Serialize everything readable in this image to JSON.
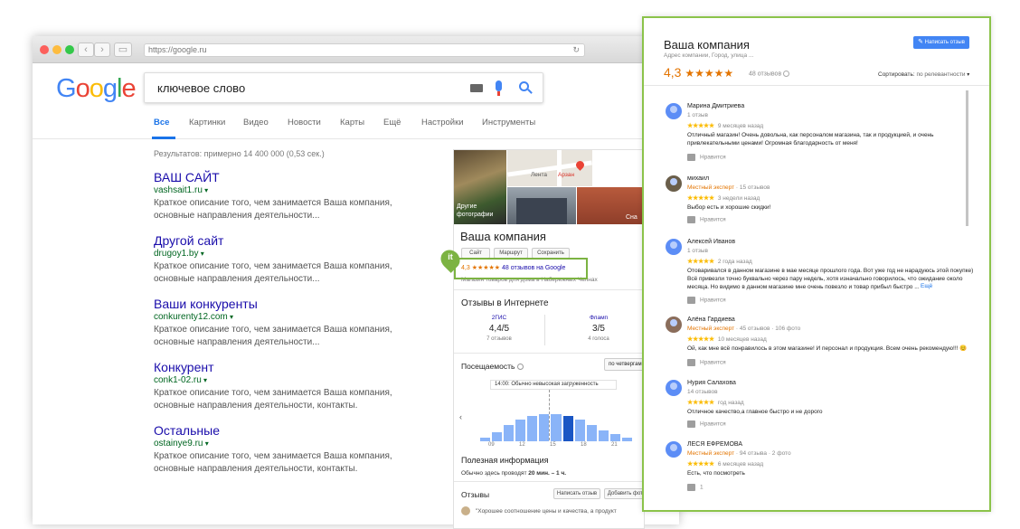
{
  "browser": {
    "url": "https://google.ru",
    "logo_letters": [
      "G",
      "o",
      "o",
      "g",
      "l",
      "e"
    ],
    "logo_colors": [
      "#4285f4",
      "#ea4335",
      "#fbbc05",
      "#4285f4",
      "#34a853",
      "#ea4335"
    ]
  },
  "search": {
    "query": "ключевое слово"
  },
  "tabs": [
    "Все",
    "Картинки",
    "Видео",
    "Новости",
    "Карты",
    "Ещё",
    "Настройки",
    "Инструменты"
  ],
  "stats": "Результатов: примерно 14 400 000 (0,53 сек.)",
  "results": [
    {
      "title": "ВАШ САЙТ",
      "url": "vashsait1.ru",
      "desc1": "Краткое описание того, чем занимается Ваша компания,",
      "desc2": "основные направления деятельности..."
    },
    {
      "title": "Другой сайт",
      "url": "drugoy1.by",
      "desc1": "Краткое описание того, чем занимается Ваша компания,",
      "desc2": "основные направления деятельности..."
    },
    {
      "title": "Ваши конкуренты",
      "url": "conkurenty12.com",
      "desc1": "Краткое описание того, чем занимается Ваша компания,",
      "desc2": "основные направления деятельности..."
    },
    {
      "title": "Конкурент",
      "url": "conk1-02.ru",
      "desc1": "Краткое описание того, чем занимается Ваша компания,",
      "desc2": "основные направления деятельности, контакты."
    },
    {
      "title": "Остальные",
      "url": "ostainye9.ru",
      "desc1": "Краткое описание того, чем занимается Ваша компания,",
      "desc2": "основные направления деятельности, контакты."
    }
  ],
  "knowledge_panel": {
    "photos_label_1": "Другие",
    "photos_label_2": "фотографии",
    "map_label_1": "Лента",
    "map_label_2": "Арзан",
    "photo_right_label": "Сна",
    "title": "Ваша компания",
    "buttons": [
      "Сайт",
      "Маршрут",
      "Сохранить"
    ],
    "rating": "4,3",
    "stars": "★★★★★",
    "reviews_link": "48 отзывов на Google",
    "category": "Магазин товаров для дома в Набережных Челнах",
    "online_reviews_title": "Отзывы в Интернете",
    "sources": [
      {
        "name": "2ГИС",
        "score": "4,4/5",
        "count": "7 отзывов"
      },
      {
        "name": "Фламп",
        "score": "3/5",
        "count": "4 голоса"
      }
    ],
    "attendance_title": "Посещаемость",
    "attendance_btn": "по четвергам",
    "attendance_now": "14:00: Обычно невысокая загруженность",
    "hours": [
      "09",
      "12",
      "15",
      "18",
      "21"
    ],
    "bars": [
      0.1,
      0.25,
      0.45,
      0.6,
      0.7,
      0.75,
      0.75,
      0.7,
      0.6,
      0.45,
      0.3,
      0.2,
      0.1
    ],
    "useful_title": "Полезная информация",
    "useful_text_a": "Обычно здесь проводят ",
    "useful_text_b": "20 мин. – 1 ч.",
    "reviews_title": "Отзывы",
    "write_btn": "Написать отзыв",
    "add_btn": "Добавить фото",
    "quote": "\"Хорошее соотношение цены и качества, а продукт",
    "badge": "it"
  },
  "review_panel": {
    "title": "Ваша компания",
    "address": "Адрес компании, Город, улица ...",
    "write_btn": "Написать отзыв",
    "rating": "4,3",
    "stars": "★★★★★",
    "count": "48 отзывов",
    "sort_label": "Сортировать:",
    "sort_value": "по релевантности",
    "like_label": "Нравится",
    "more": "Ещё",
    "reviews": [
      {
        "name": "Марина Дмитриева",
        "meta": "1 отзыв",
        "expert": "",
        "stars": "★★★★★",
        "ago": "9 месяцев назад",
        "text": "Отличный магазин! Очень довольна, как персоналом магазина, так и продукцией, и очень привлекательными ценами! Огромная благодарность от меня!",
        "likes": ""
      },
      {
        "name": "михаил",
        "meta": " · 15 отзывов",
        "expert": "Местный эксперт",
        "stars": "★★★★★",
        "ago": "3 недели назад",
        "text": "Выбор есть и хорошие скидки!",
        "likes": ""
      },
      {
        "name": "Алексей Иванов",
        "meta": "1 отзыв",
        "expert": "",
        "stars": "★★★★★",
        "ago": "2 года назад",
        "text": "Отоваривался в данном магазине в мае месяце прошлого года. Вот уже год не нарадуюсь этой покупке) Всё привезли точно буквально через пару недель, хотя изначально говорилось, что ожидание около месяца. Но видимо в данном магазине мне очень повезло и товар прибыл быстро ...",
        "likes": ""
      },
      {
        "name": "Алёна Гардиева",
        "meta": " · 45 отзывов · 106 фото",
        "expert": "Местный эксперт",
        "stars": "★★★★★",
        "ago": "10 месяцев назад",
        "text": "Ой, как мне всё понравилось в этом магазине! И персонал и продукция. Всем очень рекомендую!!! 😊",
        "likes": ""
      },
      {
        "name": "Нурия Салахова",
        "meta": "14 отзывов",
        "expert": "",
        "stars": "★★★★★",
        "ago": "год назад",
        "text": "Отличное качество,а главное быстро и не дорого",
        "likes": ""
      },
      {
        "name": "ЛЕСЯ ЕФРЕМОВА",
        "meta": " · 94 отзыва · 2 фото",
        "expert": "Местный эксперт",
        "stars": "★★★★★",
        "ago": "6 месяцев назад",
        "text": "Есть, что посмотреть",
        "likes": "1"
      }
    ]
  }
}
